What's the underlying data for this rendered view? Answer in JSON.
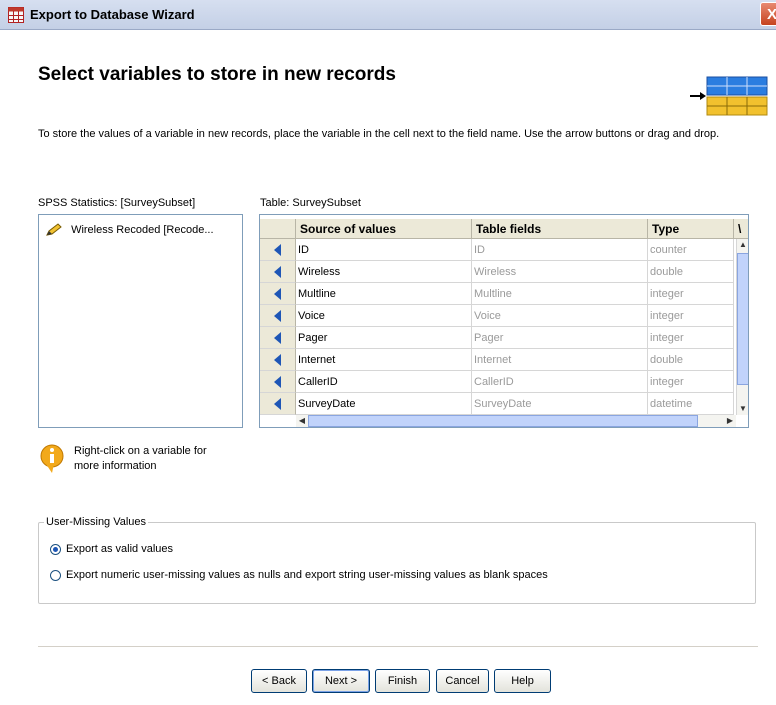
{
  "window": {
    "title": "Export to Database Wizard",
    "close_glyph": "X",
    "app_icon": "table-icon"
  },
  "header": {
    "title": "Select variables to store in new records",
    "description": "To store the values of a variable in new records, place the variable in the cell next to the field name. Use the arrow buttons or drag and drop."
  },
  "variables": {
    "label": "SPSS Statistics:  [SurveySubset]",
    "items": [
      {
        "label": "Wireless Recoded [Recode..."
      }
    ]
  },
  "table": {
    "label": "Table: SurveySubset",
    "columns": [
      "Source of values",
      "Table fields",
      "Type",
      "\\"
    ],
    "rows": [
      {
        "source": "ID",
        "field": "ID",
        "type": "counter"
      },
      {
        "source": "Wireless",
        "field": "Wireless",
        "type": "double"
      },
      {
        "source": "Multline",
        "field": "Multline",
        "type": "integer"
      },
      {
        "source": "Voice",
        "field": "Voice",
        "type": "integer"
      },
      {
        "source": "Pager",
        "field": "Pager",
        "type": "integer"
      },
      {
        "source": "Internet",
        "field": "Internet",
        "type": "double"
      },
      {
        "source": "CallerID",
        "field": "CallerID",
        "type": "integer"
      },
      {
        "source": "SurveyDate",
        "field": "SurveyDate",
        "type": "datetime"
      }
    ]
  },
  "info": {
    "line1": "Right-click on a variable for",
    "line2": "more information"
  },
  "missing": {
    "legend": "User-Missing Values",
    "options": [
      {
        "label": "Export as valid values",
        "selected": true
      },
      {
        "label": "Export numeric user-missing values as nulls and export string user-missing values as blank spaces",
        "selected": false
      }
    ]
  },
  "buttons": {
    "back": "< Back",
    "next": "Next >",
    "finish": "Finish",
    "cancel": "Cancel",
    "help": "Help"
  },
  "colors": {
    "accent": "#1e56b6",
    "header_grid_blue": "#2b7de0",
    "header_grid_yellow": "#f2c12e"
  }
}
